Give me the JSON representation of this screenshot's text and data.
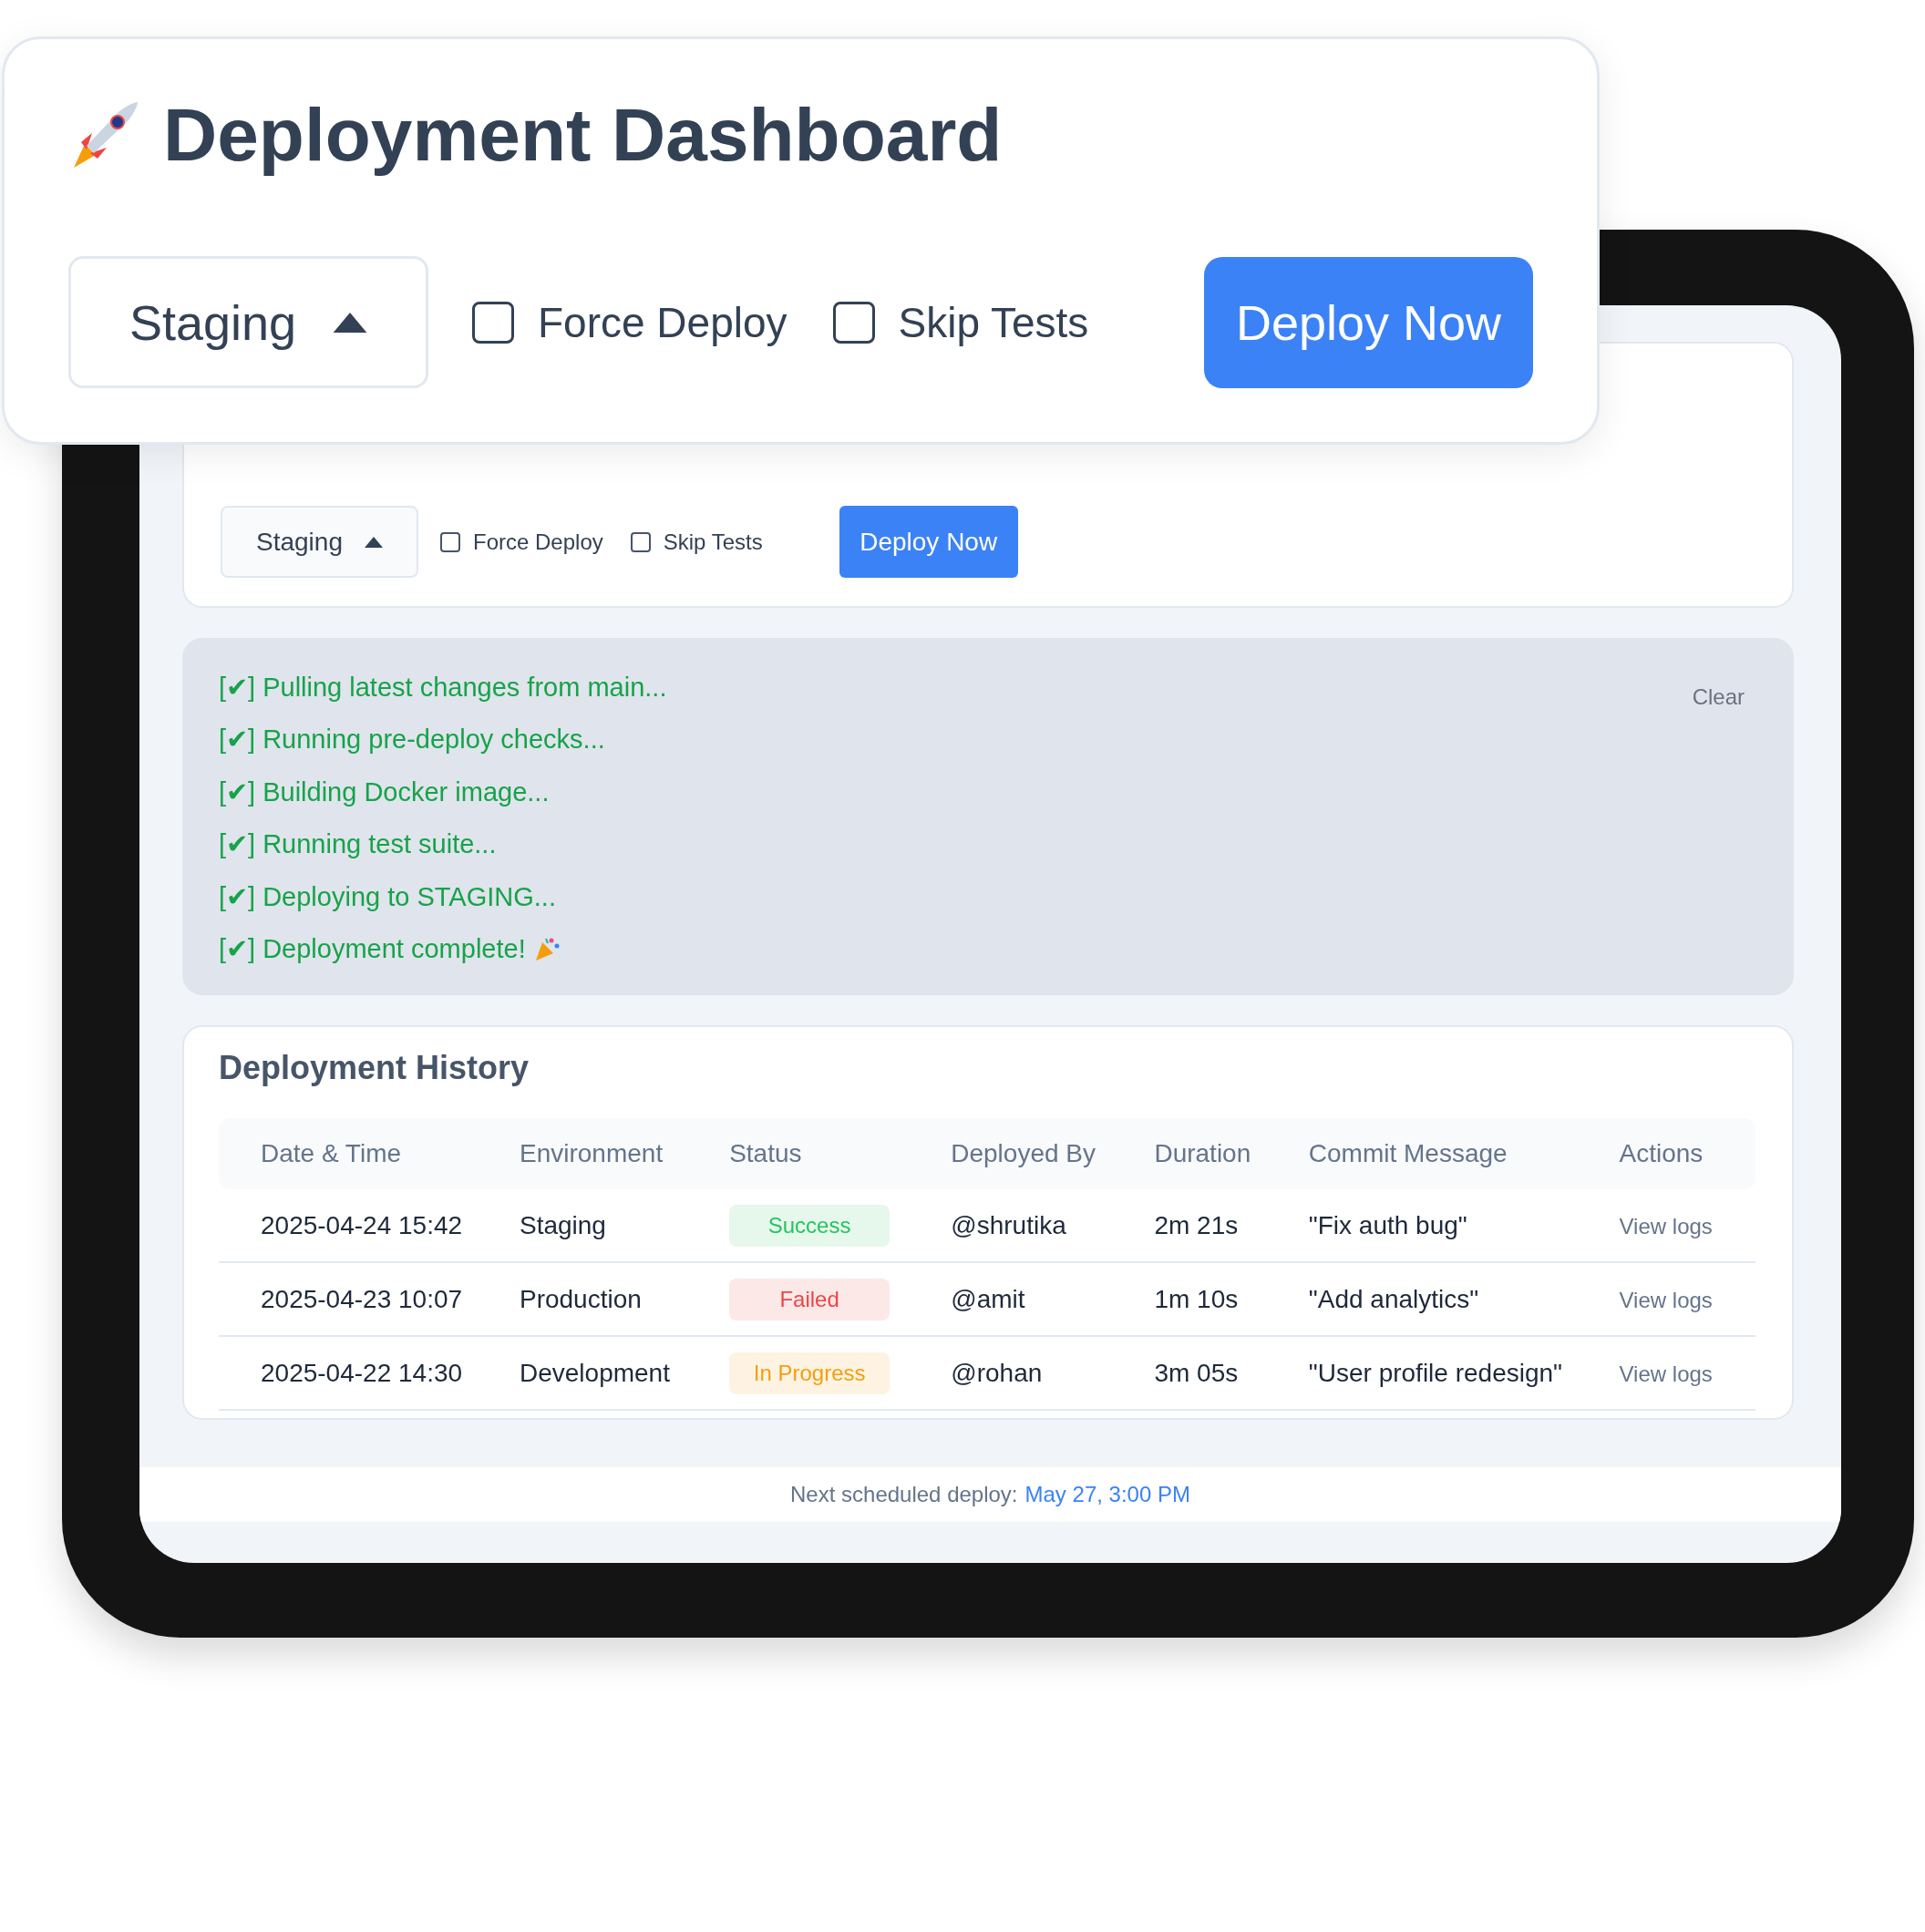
{
  "callout": {
    "title": "Deployment Dashboard",
    "environment": {
      "value": "Staging",
      "expanded": true
    },
    "options": [
      {
        "label": "Force Deploy",
        "checked": false
      },
      {
        "label": "Skip Tests",
        "checked": false
      }
    ],
    "deploy_button": "Deploy Now"
  },
  "dashboard": {
    "environment": {
      "value": "Staging",
      "expanded": true
    },
    "options": [
      {
        "label": "Force Deploy",
        "checked": false
      },
      {
        "label": "Skip Tests",
        "checked": false
      }
    ],
    "deploy_button": "Deploy Now"
  },
  "log": {
    "lines": [
      "[✔] Pulling latest changes from main...",
      "[✔] Running pre-deploy checks...",
      "[✔] Building Docker image...",
      "[✔] Running test suite...",
      "[✔] Deploying to STAGING...",
      "[✔] Deployment complete!"
    ],
    "clear_button": "Clear"
  },
  "history": {
    "title": "Deployment History",
    "columns": [
      "Date & Time",
      "Environment",
      "Status",
      "Deployed By",
      "Duration",
      "Commit Message",
      "Actions"
    ],
    "rows": [
      {
        "date": "2025-04-24 15:42",
        "environment": "Staging",
        "status": {
          "label": "Success",
          "kind": "success"
        },
        "user": "@shrutika",
        "duration": "2m 21s",
        "message": "\"Fix auth bug\"",
        "action": "View logs"
      },
      {
        "date": "2025-04-23 10:07",
        "environment": "Production",
        "status": {
          "label": "Failed",
          "kind": "failed"
        },
        "user": "@amit",
        "duration": "1m 10s",
        "message": "\"Add analytics\"",
        "action": "View logs"
      },
      {
        "date": "2025-04-22 14:30",
        "environment": "Development",
        "status": {
          "label": "In Progress",
          "kind": "progress"
        },
        "user": "@rohan",
        "duration": "3m 05s",
        "message": "\"User profile redesign\"",
        "action": "View logs"
      }
    ]
  },
  "footer": {
    "label": "Next scheduled deploy:",
    "link": "May 27, 3:00 PM"
  }
}
